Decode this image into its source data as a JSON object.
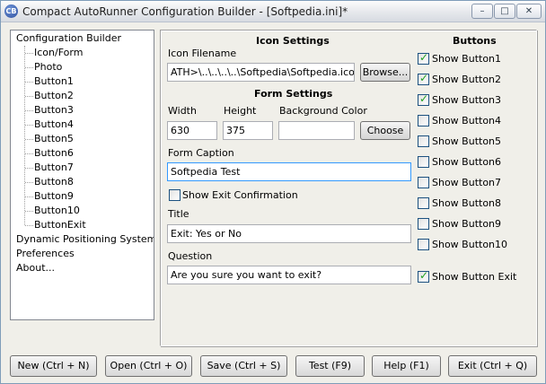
{
  "window": {
    "title": "Compact AutoRunner Configuration Builder - [Softpedia.ini]*",
    "icon_text": "CB",
    "controls": {
      "minimize": "–",
      "maximize": "□",
      "close": "✕"
    }
  },
  "tree": {
    "root": "Configuration Builder",
    "children": [
      "Icon/Form",
      "Photo",
      "Button1",
      "Button2",
      "Button3",
      "Button4",
      "Button5",
      "Button6",
      "Button7",
      "Button8",
      "Button9",
      "Button10",
      "ButtonExit"
    ],
    "other_roots": [
      "Dynamic Positioning System",
      "Preferences",
      "About..."
    ]
  },
  "icon_settings": {
    "heading": "Icon Settings",
    "filename_label": "Icon Filename",
    "filename_value": "ATH>\\..\\..\\..\\..\\Softpedia\\Softpedia.ico",
    "browse_label": "Browse..."
  },
  "form_settings": {
    "heading": "Form Settings",
    "width_label": "Width",
    "width_value": "630",
    "height_label": "Height",
    "height_value": "375",
    "bg_label": "Background Color",
    "bg_value": "",
    "choose_label": "Choose",
    "caption_label": "Form Caption",
    "caption_value": "Softpedia Test",
    "exit_confirm_label": "Show Exit Confirmation",
    "exit_confirm_checked": false,
    "title_label": "Title",
    "title_value": "Exit: Yes or No",
    "question_label": "Question",
    "question_value": "Are you sure you want to exit?"
  },
  "buttons": {
    "heading": "Buttons",
    "items": [
      {
        "label": "Show Button1",
        "checked": true
      },
      {
        "label": "Show Button2",
        "checked": true
      },
      {
        "label": "Show Button3",
        "checked": true
      },
      {
        "label": "Show Button4",
        "checked": false
      },
      {
        "label": "Show Button5",
        "checked": false
      },
      {
        "label": "Show Button6",
        "checked": false
      },
      {
        "label": "Show Button7",
        "checked": false
      },
      {
        "label": "Show Button8",
        "checked": false
      },
      {
        "label": "Show Button9",
        "checked": false
      },
      {
        "label": "Show Button10",
        "checked": false
      }
    ],
    "exit": {
      "label": "Show Button Exit",
      "checked": true
    }
  },
  "bottom": {
    "new": "New (Ctrl + N)",
    "open": "Open (Ctrl + O)",
    "save": "Save (Ctrl + S)",
    "test": "Test (F9)",
    "help": "Help (F1)",
    "exit": "Exit (Ctrl + Q)"
  }
}
